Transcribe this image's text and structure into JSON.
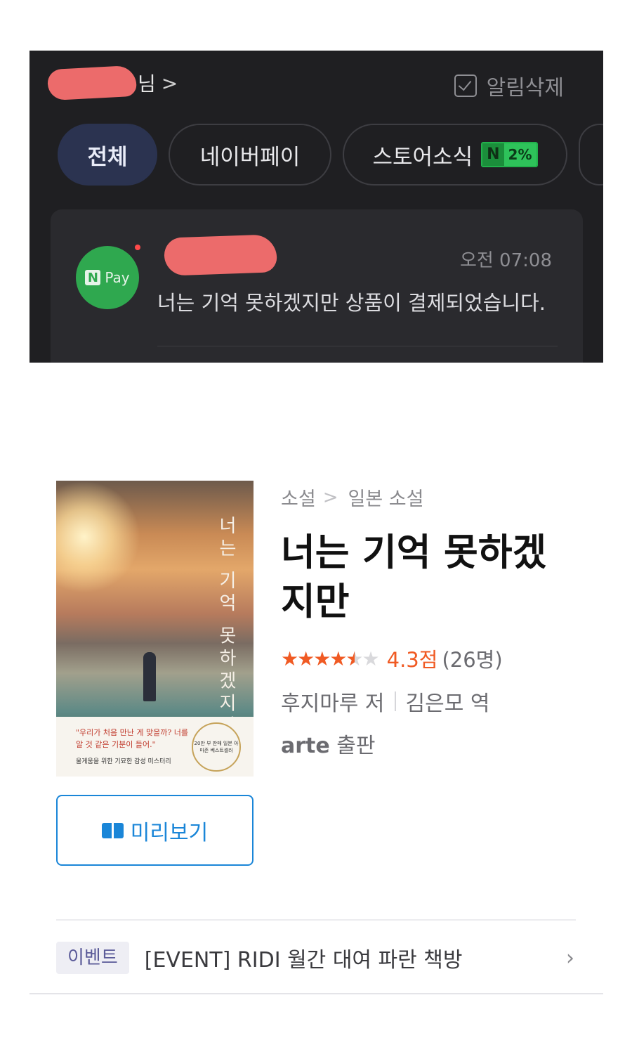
{
  "notifications": {
    "user_suffix": "님",
    "user_chevron": ">",
    "delete_label": "알림삭제",
    "tabs": [
      {
        "label": "전체",
        "active": true
      },
      {
        "label": "네이버페이",
        "active": false
      },
      {
        "label": "스토어소식",
        "active": false,
        "badge_n": "N",
        "badge_pct": "2%"
      }
    ],
    "card": {
      "time": "오전 07:08",
      "message": "너는 기억 못하겠지만 상품이 결제되었습니다.",
      "avatar_n": "N",
      "avatar_pay": "Pay"
    }
  },
  "book": {
    "breadcrumb": [
      "소설",
      "일본 소설"
    ],
    "breadcrumb_sep": ">",
    "title": "너는 기억 못하겠지만",
    "rating": {
      "stars": 4.3,
      "score": "4.3점",
      "count": "(26명)"
    },
    "author": "후지마루 저",
    "translator": "김은모 역",
    "publisher_name": "arte",
    "publisher_suffix": "출판",
    "preview_label": "미리보기",
    "cover": {
      "title": "너는 기억 못하겠지만",
      "quote": "\"우리가 처음 만난 게 맞을까? 너를 알 것 같은 기분이 들어.\"",
      "tagline": "울게움을 위한 기묘한 감성 미스터리",
      "seal": "20만 부 판매 일본 아마존 베스트셀러"
    }
  },
  "event": {
    "badge": "이벤트",
    "text": "[EVENT] RIDI 월간 대여 파란 책방",
    "chevron": "›"
  },
  "colors": {
    "accent_blue": "#1a86d8",
    "rating_orange": "#f05a23",
    "npay_green": "#2fa84f",
    "dark_bg": "#1f1f22"
  }
}
